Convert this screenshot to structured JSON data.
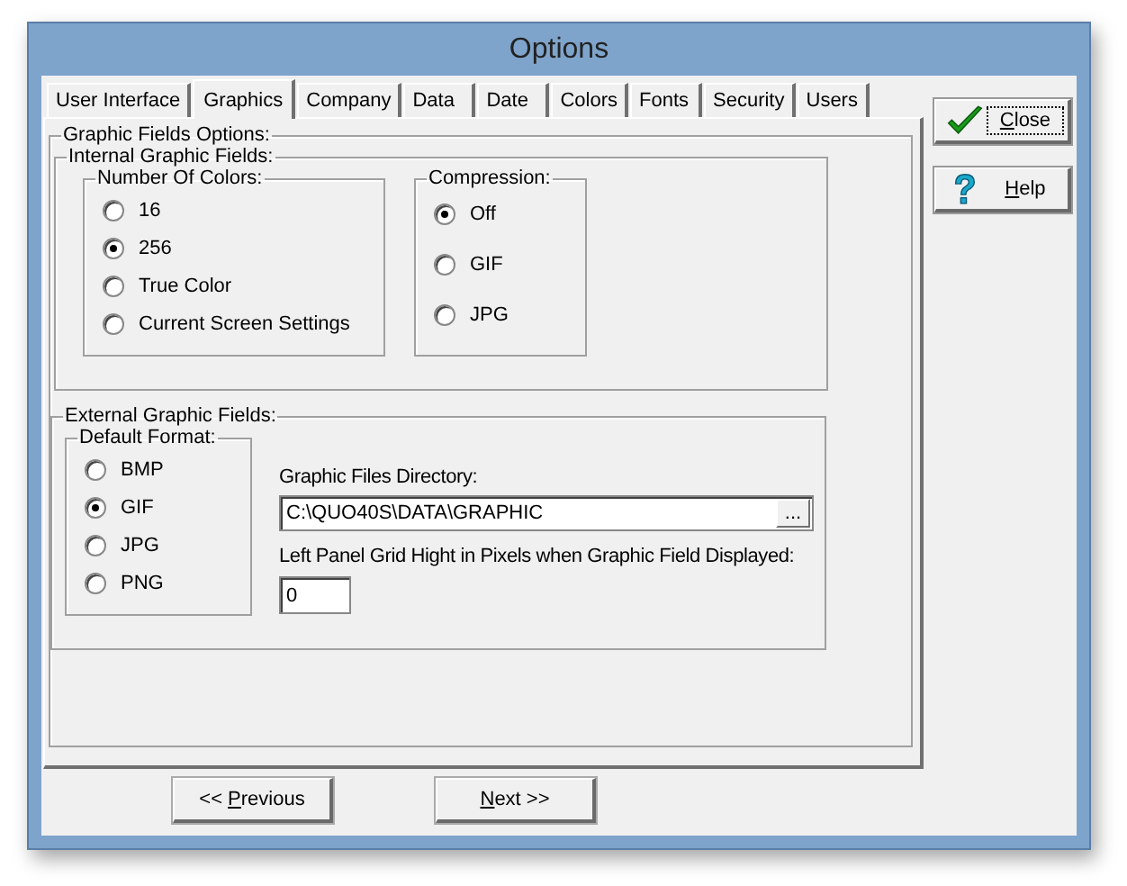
{
  "window": {
    "title": "Options"
  },
  "tabs": [
    {
      "label": "User Interface",
      "selected": false
    },
    {
      "label": "Graphics",
      "selected": true
    },
    {
      "label": "Company",
      "selected": false
    },
    {
      "label": "Data",
      "selected": false
    },
    {
      "label": "Date",
      "selected": false
    },
    {
      "label": "Colors",
      "selected": false
    },
    {
      "label": "Fonts",
      "selected": false
    },
    {
      "label": "Security",
      "selected": false
    },
    {
      "label": "Users",
      "selected": false
    }
  ],
  "graphic_fields": {
    "title": "Graphic Fields Options:",
    "internal": {
      "title": "Internal Graphic Fields:",
      "colors": {
        "title": "Number Of Colors:",
        "options": [
          {
            "label": "16",
            "selected": false
          },
          {
            "label": "256",
            "selected": true
          },
          {
            "label": "True Color",
            "selected": false
          },
          {
            "label": "Current Screen Settings",
            "selected": false
          }
        ]
      },
      "compression": {
        "title": "Compression:",
        "options": [
          {
            "label": "Off",
            "selected": true
          },
          {
            "label": "GIF",
            "selected": false
          },
          {
            "label": "JPG",
            "selected": false
          }
        ]
      }
    },
    "external": {
      "title": "External Graphic Fields:",
      "format": {
        "title": "Default Format:",
        "options": [
          {
            "label": "BMP",
            "selected": false
          },
          {
            "label": "GIF",
            "selected": true
          },
          {
            "label": "JPG",
            "selected": false
          },
          {
            "label": "PNG",
            "selected": false
          }
        ]
      },
      "directory": {
        "label": "Graphic Files Directory:",
        "value": "C:\\QUO40S\\DATA\\GRAPHIC",
        "browse": "..."
      },
      "grid_height": {
        "label": "Left Panel Grid Hight in Pixels when Graphic Field Displayed:",
        "value": "0"
      }
    }
  },
  "side_buttons": [
    {
      "kind": "close",
      "label": {
        "key": "C",
        "rest": "lose"
      },
      "focused": true
    },
    {
      "kind": "help",
      "label": {
        "key": "H",
        "rest": "elp"
      },
      "focused": false
    }
  ],
  "nav_buttons": [
    {
      "label": {
        "lead": "<< ",
        "key": "P",
        "rest": "revious"
      }
    },
    {
      "label": {
        "key": "N",
        "rest": "ext >>"
      }
    }
  ]
}
